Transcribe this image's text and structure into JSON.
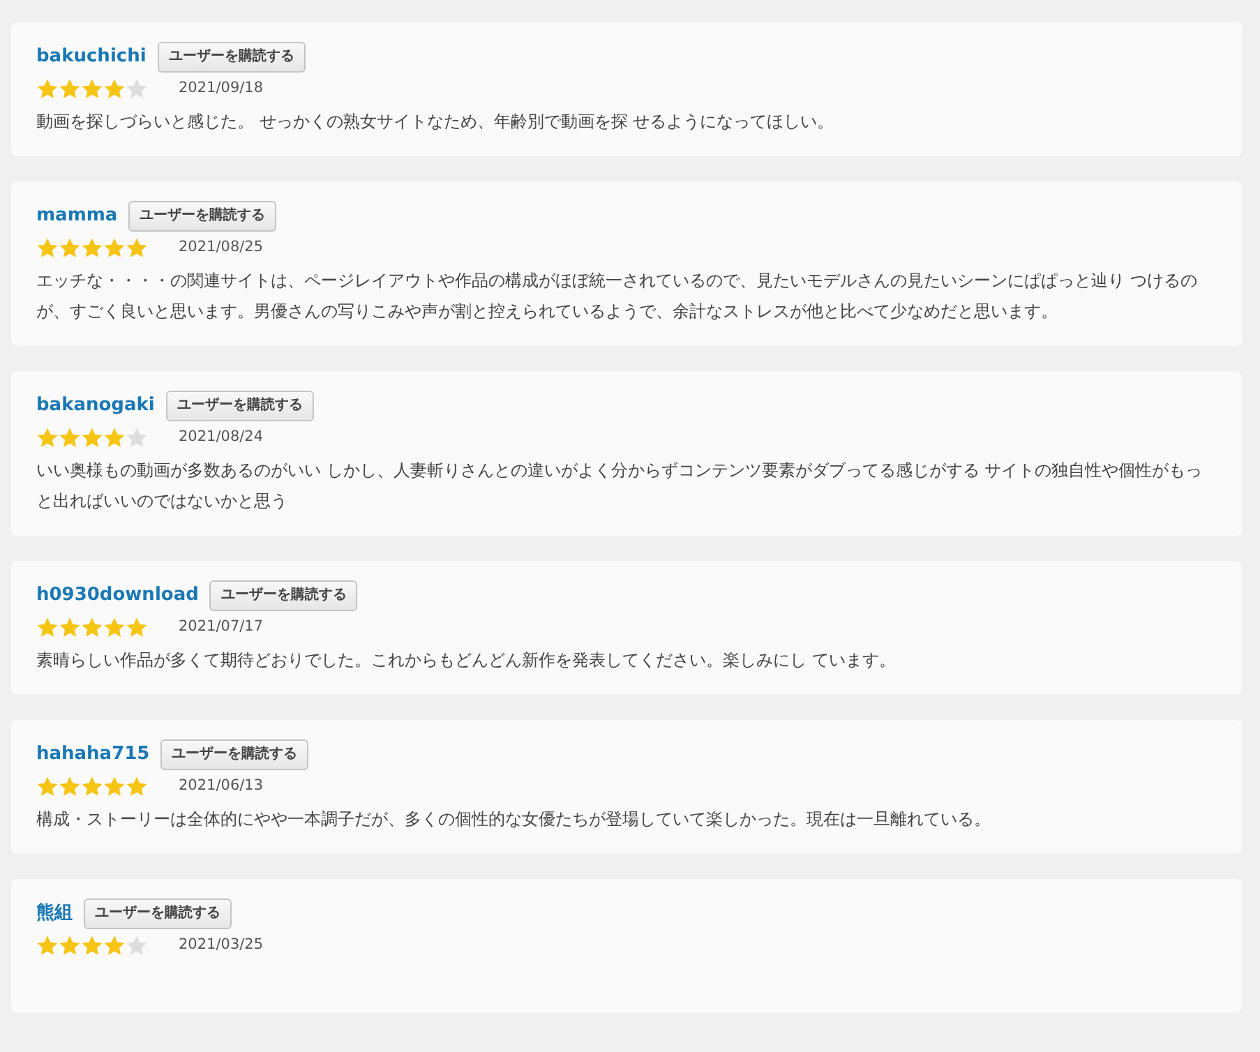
{
  "reviews": [
    {
      "user": "bakuchichi",
      "subscribe": "ユーザーを購読する",
      "stars": 4,
      "date": "2021/09/18",
      "text": "動画を探しづらいと感じた。 せっかくの熟女サイトなため、年齢別で動画を探 せるようになってほしい。"
    },
    {
      "user": "mamma",
      "subscribe": "ユーザーを購読する",
      "stars": 5,
      "date": "2021/08/25",
      "text": "エッチな・・・・の関連サイトは、ページレイアウトや作品の構成がほぼ統一されているので、見たいモデルさんの見たいシーンにぱぱっと辿り つけるのが、すごく良いと思います。男優さんの写りこみや声が割と控えられているようで、余計なストレスが他と比べて少なめだと思います。"
    },
    {
      "user": "bakanogaki",
      "subscribe": "ユーザーを購読する",
      "stars": 4,
      "date": "2021/08/24",
      "text": "いい奥様もの動画が多数あるのがいい しかし、人妻斬りさんとの違いがよく分からずコンテンツ要素がダブってる感じがする サイトの独自性や個性がもっと出ればいいのではないかと思う"
    },
    {
      "user": "h0930download",
      "subscribe": "ユーザーを購読する",
      "stars": 5,
      "date": "2021/07/17",
      "text": "素晴らしい作品が多くて期待どおりでした。これからもどんどん新作を発表してください。楽しみにし ています。"
    },
    {
      "user": "hahaha715",
      "subscribe": "ユーザーを購読する",
      "stars": 5,
      "date": "2021/06/13",
      "text": "構成・ストーリーは全体的にやや一本調子だが、多くの個性的な女優たちが登場していて楽しかった。現在は一旦離れている。"
    },
    {
      "user": "熊組",
      "subscribe": "ユーザーを購読する",
      "stars": 4,
      "date": "2021/03/25"
    }
  ]
}
